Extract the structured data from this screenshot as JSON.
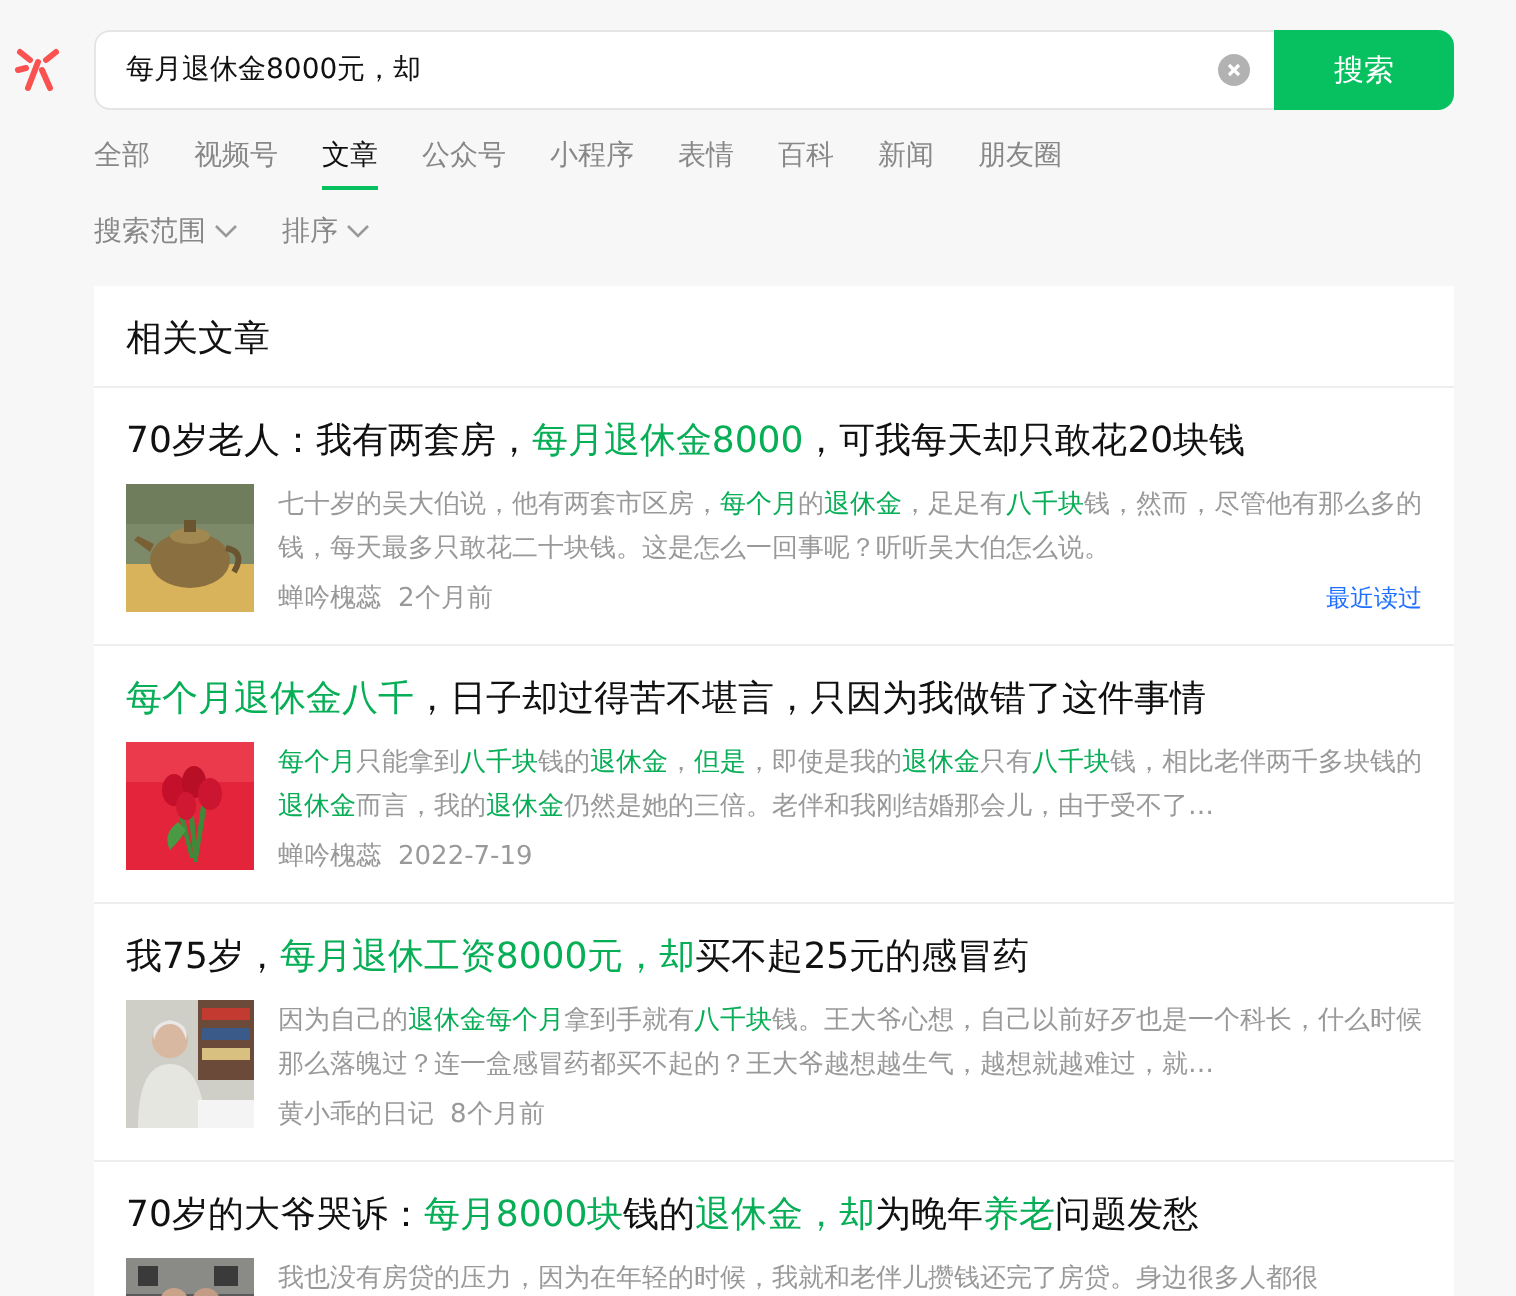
{
  "search": {
    "value": "每月退休金8000元，却",
    "button": "搜索"
  },
  "tabs": [
    {
      "label": "全部",
      "selected": false
    },
    {
      "label": "视频号",
      "selected": false
    },
    {
      "label": "文章",
      "selected": true
    },
    {
      "label": "公众号",
      "selected": false
    },
    {
      "label": "小程序",
      "selected": false
    },
    {
      "label": "表情",
      "selected": false
    },
    {
      "label": "百科",
      "selected": false
    },
    {
      "label": "新闻",
      "selected": false
    },
    {
      "label": "朋友圈",
      "selected": false
    }
  ],
  "filters": [
    {
      "label": "搜索范围"
    },
    {
      "label": "排序"
    }
  ],
  "section": {
    "title": "相关文章"
  },
  "articles": [
    {
      "title": [
        {
          "text": "70岁老人：我有两套房，",
          "highlight": false
        },
        {
          "text": "每月退休金8000",
          "highlight": true
        },
        {
          "text": "，可我每天却只敢花20块钱",
          "highlight": false
        }
      ],
      "snippet": [
        {
          "text": "七十岁的吴大伯说，他有两套市区房，",
          "highlight": false
        },
        {
          "text": "每个月",
          "highlight": true
        },
        {
          "text": "的",
          "highlight": false
        },
        {
          "text": "退休金",
          "highlight": true
        },
        {
          "text": "，足足有",
          "highlight": false
        },
        {
          "text": "八千块",
          "highlight": true
        },
        {
          "text": "钱，然而，尽管他有那么多的钱，每天最多只敢花二十块钱。这是怎么一回事呢？听听吴大伯怎么说。",
          "highlight": false
        }
      ],
      "source": "蝉吟槐蕊",
      "time": "2个月前",
      "badge": "最近读过"
    },
    {
      "title": [
        {
          "text": "每个月退休金八千",
          "highlight": true
        },
        {
          "text": "，日子却过得苦不堪言，只因为我做错了这件事情",
          "highlight": false
        }
      ],
      "snippet": [
        {
          "text": "每个月",
          "highlight": true
        },
        {
          "text": "只能拿到",
          "highlight": false
        },
        {
          "text": "八千块",
          "highlight": true
        },
        {
          "text": "钱的",
          "highlight": false
        },
        {
          "text": "退休金",
          "highlight": true
        },
        {
          "text": "，",
          "highlight": false
        },
        {
          "text": "但是",
          "highlight": true
        },
        {
          "text": "，即使是我的",
          "highlight": false
        },
        {
          "text": "退休金",
          "highlight": true
        },
        {
          "text": "只有",
          "highlight": false
        },
        {
          "text": "八千块",
          "highlight": true
        },
        {
          "text": "钱，相比老伴两千多块钱的",
          "highlight": false
        },
        {
          "text": "退休金",
          "highlight": true
        },
        {
          "text": "而言，我的",
          "highlight": false
        },
        {
          "text": "退休金",
          "highlight": true
        },
        {
          "text": "仍然是她的三倍。老伴和我刚结婚那会儿，由于受不了…",
          "highlight": false
        }
      ],
      "source": "蝉吟槐蕊",
      "time": "2022-7-19"
    },
    {
      "title": [
        {
          "text": "我75岁，",
          "highlight": false
        },
        {
          "text": "每月退休工资8000元，却",
          "highlight": true
        },
        {
          "text": "买不起25元的感冒药",
          "highlight": false
        }
      ],
      "snippet": [
        {
          "text": "因为自己的",
          "highlight": false
        },
        {
          "text": "退休金每个月",
          "highlight": true
        },
        {
          "text": "拿到手就有",
          "highlight": false
        },
        {
          "text": "八千块",
          "highlight": true
        },
        {
          "text": "钱。王大爷心想，自己以前好歹也是一个科长，什么时候那么落魄过？连一盒感冒药都买不起的？王大爷越想越生气，越想就越难过，就…",
          "highlight": false
        }
      ],
      "source": "黄小乖的日记",
      "time": "8个月前"
    },
    {
      "title": [
        {
          "text": "70岁的大爷哭诉：",
          "highlight": false
        },
        {
          "text": "每月8000块",
          "highlight": true
        },
        {
          "text": "钱的",
          "highlight": false
        },
        {
          "text": "退休金，却",
          "highlight": true
        },
        {
          "text": "为晚年",
          "highlight": false
        },
        {
          "text": "养老",
          "highlight": true
        },
        {
          "text": "问题发愁",
          "highlight": false
        }
      ],
      "snippet": [
        {
          "text": "我也没有房贷的压力，因为在年轻的时候，我就和老伴儿攒钱还完了房贷。身边很多人都很",
          "highlight": false
        }
      ]
    }
  ]
}
